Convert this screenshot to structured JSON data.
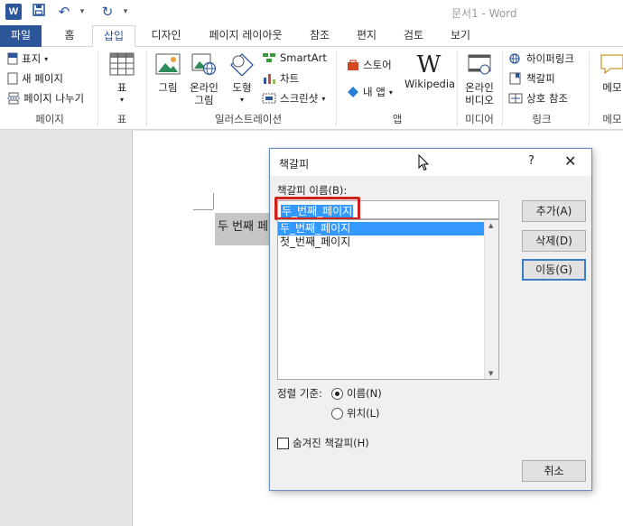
{
  "window": {
    "title": "문서1 - Word",
    "qat": {
      "logo": "W",
      "icons": [
        "word-logo-icon",
        "save-icon",
        "undo-icon",
        "redo-icon",
        "customize-icon"
      ]
    }
  },
  "tabs": [
    "파일",
    "홈",
    "삽입",
    "디자인",
    "페이지 레이아웃",
    "참조",
    "편지",
    "검토",
    "보기"
  ],
  "ribbon": {
    "pages": {
      "cover": "표지",
      "blank": "새 페이지",
      "break": "페이지 나누기",
      "label": "페이지"
    },
    "table": {
      "button": "표",
      "label": "표"
    },
    "illustrations": {
      "picture": "그림",
      "online_picture_1": "온라인",
      "online_picture_2": "그림",
      "shapes": "도형",
      "smartart": "SmartArt",
      "chart": "차트",
      "screenshot": "스크린샷",
      "label": "일러스트레이션"
    },
    "apps": {
      "store": "스토어",
      "myapps": "내 앱",
      "wikipedia": "Wikipedia",
      "label": "앱"
    },
    "media": {
      "video_1": "온라인",
      "video_2": "비디오",
      "label": "미디어"
    },
    "links": {
      "hyperlink": "하이퍼링크",
      "bookmark": "책갈피",
      "crossref": "상호 참조",
      "label": "링크"
    },
    "comments": {
      "comment": "메모",
      "label": "메모"
    }
  },
  "document": {
    "text": "두 번째 페이지"
  },
  "dialog": {
    "title": "책갈피",
    "help": "?",
    "close": "✕",
    "name_label": "책갈피 이름(B):",
    "name_value": "두_번째_페이지",
    "bookmarks": [
      "두_번째_페이지",
      "첫_번째_페이지"
    ],
    "buttons": {
      "add": "추가(A)",
      "delete": "삭제(D)",
      "goto": "이동(G)",
      "cancel": "취소"
    },
    "sort_label": "정렬 기준:",
    "sort_options": [
      "이름(N)",
      "위치(L)"
    ],
    "sort_selected": "이름(N)",
    "hidden_label": "숨겨진 책갈피(H)"
  }
}
